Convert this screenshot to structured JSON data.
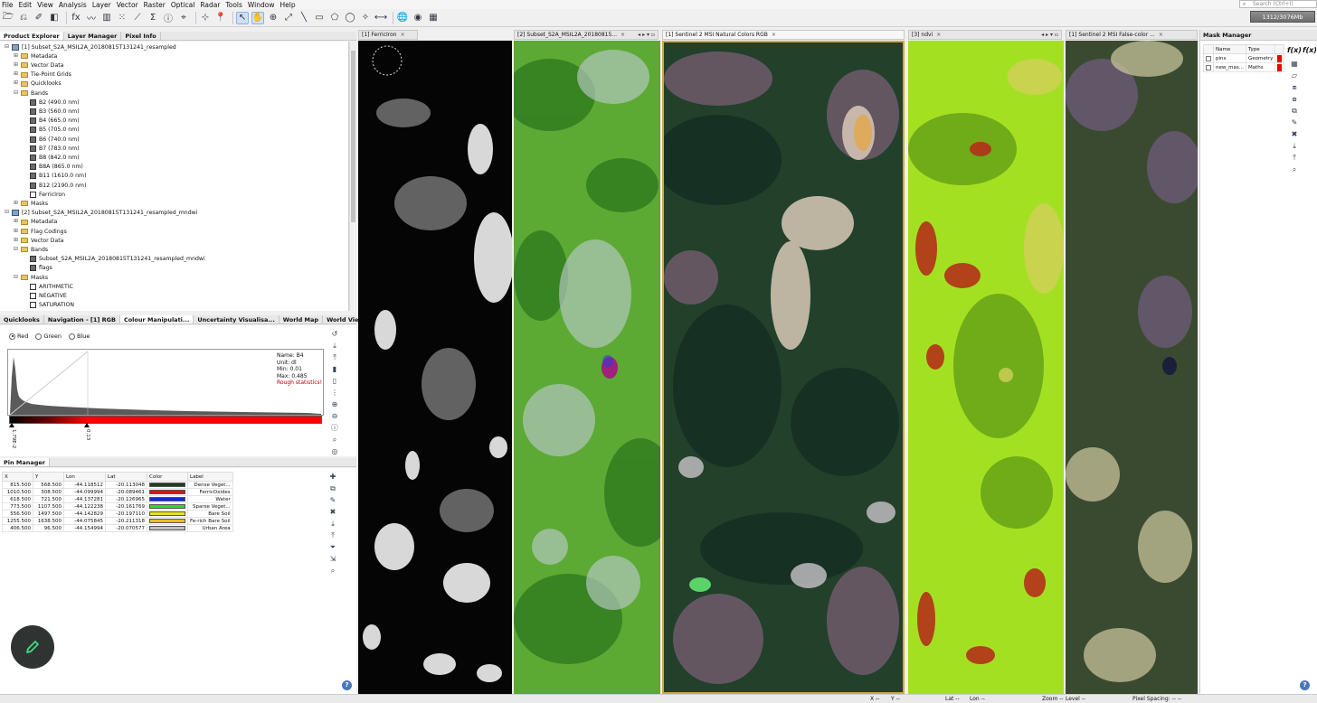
{
  "menu": [
    "File",
    "Edit",
    "View",
    "Analysis",
    "Layer",
    "Vector",
    "Raster",
    "Optical",
    "Radar",
    "Tools",
    "Window",
    "Help"
  ],
  "search_placeholder": "Search (Ctrl+I)",
  "memory": "1312/3076Mb",
  "toolbar_icons": [
    "open-product-icon",
    "session-icon",
    "new-vector-icon",
    "layer-icon",
    "band-maths-icon",
    "spectrum-icon",
    "histogram-icon",
    "scatter-plot-icon",
    "profile-plot-icon",
    "statistics-icon",
    "information-icon",
    "pixel-info-icon",
    "gcp-icon",
    "pin-tool-icon",
    "select-tool-icon",
    "pan-tool-icon",
    "zoom-in-tool-icon",
    "zoom-all-icon",
    "draw-line-icon",
    "draw-rectangle-icon",
    "draw-polygon-icon",
    "draw-ellipse-icon",
    "magic-wand-icon",
    "range-finder-icon",
    "world-view-icon",
    "globe-icon",
    "tile-icon"
  ],
  "top_tabs": [
    "Product Explorer",
    "Layer Manager",
    "Pixel Info"
  ],
  "tree": [
    {
      "level": 0,
      "icon": "prod",
      "exp": "−",
      "text": "[1] Subset_S2A_MSIL2A_20180815T131241_resampled"
    },
    {
      "level": 1,
      "icon": "fold",
      "exp": "+",
      "text": "Metadata"
    },
    {
      "level": 1,
      "icon": "fold",
      "exp": "+",
      "text": "Vector Data"
    },
    {
      "level": 1,
      "icon": "fold",
      "exp": "+",
      "text": "Tie-Point Grids"
    },
    {
      "level": 1,
      "icon": "fold",
      "exp": "+",
      "text": "Quicklooks"
    },
    {
      "level": 1,
      "icon": "fold",
      "exp": "−",
      "text": "Bands"
    },
    {
      "level": 2,
      "icon": "band",
      "exp": "",
      "text": "B2 (490.0 nm)"
    },
    {
      "level": 2,
      "icon": "band",
      "exp": "",
      "text": "B3 (560.0 nm)"
    },
    {
      "level": 2,
      "icon": "band",
      "exp": "",
      "text": "B4 (665.0 nm)"
    },
    {
      "level": 2,
      "icon": "band",
      "exp": "",
      "text": "B5 (705.0 nm)"
    },
    {
      "level": 2,
      "icon": "band",
      "exp": "",
      "text": "B6 (740.0 nm)"
    },
    {
      "level": 2,
      "icon": "band",
      "exp": "",
      "text": "B7 (783.0 nm)"
    },
    {
      "level": 2,
      "icon": "band",
      "exp": "",
      "text": "B8 (842.0 nm)"
    },
    {
      "level": 2,
      "icon": "band",
      "exp": "",
      "text": "B8A (865.0 nm)"
    },
    {
      "level": 2,
      "icon": "band",
      "exp": "",
      "text": "B11 (1610.0 nm)"
    },
    {
      "level": 2,
      "icon": "band",
      "exp": "",
      "text": "B12 (2190.0 nm)"
    },
    {
      "level": 2,
      "icon": "mask",
      "exp": "",
      "text": "FerricIron"
    },
    {
      "level": 1,
      "icon": "fold",
      "exp": "+",
      "text": "Masks"
    },
    {
      "level": 0,
      "icon": "prod",
      "exp": "−",
      "text": "[2] Subset_S2A_MSIL2A_20180815T131241_resampled_mndwi"
    },
    {
      "level": 1,
      "icon": "fold",
      "exp": "+",
      "text": "Metadata"
    },
    {
      "level": 1,
      "icon": "fold",
      "exp": "+",
      "text": "Flag Codings"
    },
    {
      "level": 1,
      "icon": "fold",
      "exp": "+",
      "text": "Vector Data"
    },
    {
      "level": 1,
      "icon": "fold",
      "exp": "−",
      "text": "Bands"
    },
    {
      "level": 2,
      "icon": "band",
      "exp": "",
      "text": "Subset_S2A_MSIL2A_20180815T131241_resampled_mndwi"
    },
    {
      "level": 2,
      "icon": "band",
      "exp": "",
      "text": "flags"
    },
    {
      "level": 1,
      "icon": "fold",
      "exp": "−",
      "text": "Masks"
    },
    {
      "level": 2,
      "icon": "mask",
      "exp": "",
      "text": "ARITHMETIC"
    },
    {
      "level": 2,
      "icon": "mask",
      "exp": "",
      "text": "NEGATIVE"
    },
    {
      "level": 2,
      "icon": "mask",
      "exp": "",
      "text": "SATURATION"
    }
  ],
  "mid_tabs": [
    "Quicklooks",
    "Navigation - [1] RGB",
    "Colour Manipulati...",
    "Uncertainty Visualisa...",
    "World Map",
    "World View"
  ],
  "colour": {
    "radios": [
      {
        "label": "Red",
        "on": true
      },
      {
        "label": "Green",
        "on": false
      },
      {
        "label": "Blue",
        "on": false
      }
    ],
    "info": [
      "Name: B4",
      "Unit: dl",
      "Min: 0.01",
      "Max: 0.485"
    ],
    "warning": "Rough statistics!",
    "slider_min": "1.79E-2",
    "slider_max": "0.13"
  },
  "pin_manager": {
    "title": "Pin Manager",
    "columns": [
      "X",
      "Y",
      "Lon",
      "Lat",
      "Color",
      "Label"
    ],
    "rows": [
      {
        "x": "815.500",
        "y": "568.500",
        "lon": "-44.118512",
        "lat": "-20.113048",
        "color": "#1f3d1f",
        "label": "Dense Veget..."
      },
      {
        "x": "1010.500",
        "y": "308.500",
        "lon": "-44.099994",
        "lat": "-20.089461",
        "color": "#e01010",
        "label": "FerricOxides"
      },
      {
        "x": "618.500",
        "y": "721.500",
        "lon": "-44.137281",
        "lat": "-20.126965",
        "color": "#1428e0",
        "label": "Water"
      },
      {
        "x": "773.500",
        "y": "1107.500",
        "lon": "-44.122238",
        "lat": "-20.161769",
        "color": "#22e022",
        "label": "Sparse Veget..."
      },
      {
        "x": "556.500",
        "y": "1497.500",
        "lon": "-44.142829",
        "lat": "-20.197110",
        "color": "#f0e010",
        "label": "Bare Soil"
      },
      {
        "x": "1255.500",
        "y": "1638.500",
        "lon": "-44.075845",
        "lat": "-20.211318",
        "color": "#f0c020",
        "label": "Fe-rich Bare Soil"
      },
      {
        "x": "406.500",
        "y": "96.500",
        "lon": "-44.154994",
        "lat": "-20.070577",
        "color": "#c0c0c0",
        "label": "Urban Area"
      }
    ]
  },
  "views": [
    {
      "label": "[1] FerricIron"
    },
    {
      "label": "[2] Subset_S2A_MSIL2A_20180815..."
    },
    {
      "label": "[1] Sentinel 2 MSI Natural Colors RGB"
    },
    {
      "label": "[3] ndvi"
    },
    {
      "label": "[1] Sentinel 2 MSI False-color ..."
    }
  ],
  "mask_manager": {
    "title": "Mask Manager",
    "columns": [
      "Name",
      "Type"
    ],
    "rows": [
      {
        "name": "pins",
        "type": "Geometry"
      },
      {
        "name": "new_mas...",
        "type": "Maths"
      }
    ],
    "fx": "f(x)",
    "xfx": "f(x)"
  },
  "status": {
    "x": "X --",
    "y": "Y --",
    "lat": "Lat --",
    "lon": "Lon --",
    "zoom": "Zoom --",
    "level": "Level --",
    "spacing": "Pixel Spacing: -- --"
  }
}
